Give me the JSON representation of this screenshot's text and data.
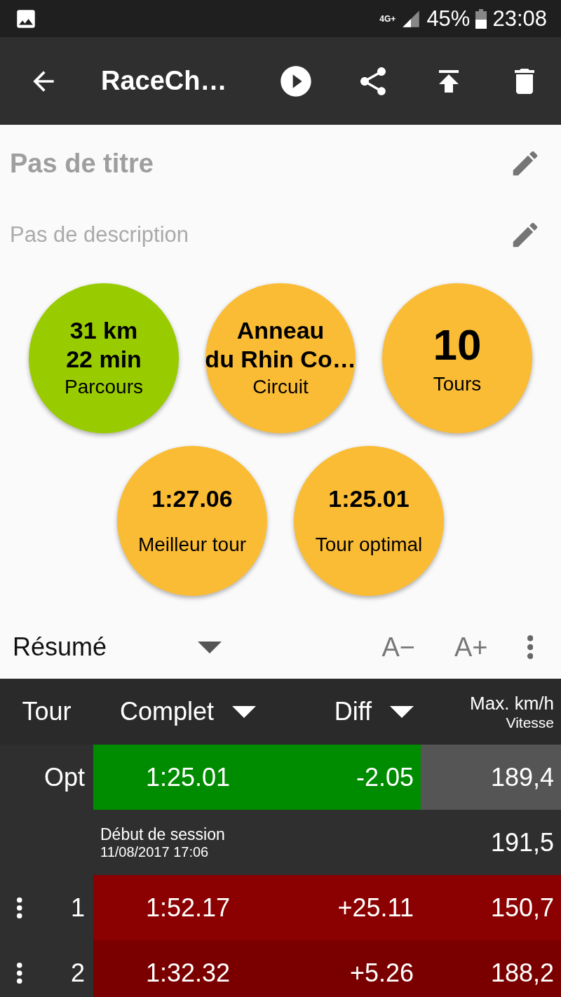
{
  "status_bar": {
    "network": "4G+",
    "battery": "45%",
    "time": "23:08"
  },
  "toolbar": {
    "title": "RaceCh…"
  },
  "session": {
    "title": "Pas de titre",
    "description": "Pas de description"
  },
  "circles": [
    {
      "kind": "stacked",
      "values": [
        "31 km",
        "22 min"
      ],
      "label": "Parcours",
      "color": "#99cc00"
    },
    {
      "kind": "stacked",
      "values": [
        "Anneau",
        "du Rhin Co…"
      ],
      "label": "Circuit",
      "color": "#fbbc35"
    },
    {
      "kind": "big",
      "values": [
        "10"
      ],
      "label": "Tours",
      "color": "#fbbc35"
    },
    {
      "kind": "time",
      "values": [
        "1:27.06"
      ],
      "label": "Meilleur tour",
      "color": "#fbbc35"
    },
    {
      "kind": "time",
      "values": [
        "1:25.01"
      ],
      "label": "Tour optimal",
      "color": "#fbbc35"
    }
  ],
  "summary_bar": {
    "view": "Résumé",
    "font_smaller": "A−",
    "font_larger": "A+"
  },
  "table": {
    "columns": [
      {
        "label": "Tour",
        "sortable": false
      },
      {
        "label": "Complet",
        "sortable": true
      },
      {
        "label": "Diff",
        "sortable": true
      },
      {
        "label": "Max. km/h",
        "sublabel": "Vitesse",
        "sortable": false
      }
    ],
    "rows": [
      {
        "kind": "opt",
        "lap": "Opt",
        "time": "1:25.01",
        "diff": "-2.05",
        "speed": "189,4",
        "color": "#008c00"
      },
      {
        "kind": "session",
        "title": "Début de session",
        "date": "11/08/2017 17:06",
        "speed": "191,5"
      },
      {
        "kind": "lap",
        "lap": "1",
        "time": "1:52.17",
        "diff": "+25.11",
        "speed": "150,7",
        "color": "#8b0000"
      },
      {
        "kind": "lap",
        "lap": "2",
        "time": "1:32.32",
        "diff": "+5.26",
        "speed": "188,2",
        "color": "#7a0000"
      }
    ]
  }
}
